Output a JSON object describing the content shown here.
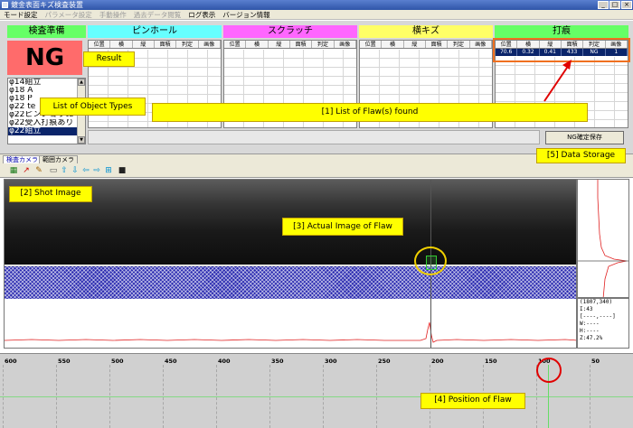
{
  "window": {
    "title": "鍍金表面キズ検査装置"
  },
  "menu": [
    {
      "label": "モード設定",
      "disabled": false
    },
    {
      "label": "パラメータ設定",
      "disabled": true
    },
    {
      "label": "手動操作",
      "disabled": true
    },
    {
      "label": "過去データ閲覧",
      "disabled": true
    },
    {
      "label": "ログ表示",
      "disabled": false
    },
    {
      "label": "バージョン情報",
      "disabled": false
    }
  ],
  "categories": {
    "inspection": "検査準備",
    "pinhole": "ピンホール",
    "scratch": "スクラッチ",
    "horizontal_flaw": "横キズ",
    "dent": "打痕"
  },
  "grid_columns": [
    "位置",
    "横",
    "縦",
    "面積",
    "判定",
    "画像"
  ],
  "dent_row": [
    "70.6",
    "0.32",
    "0.41",
    "433",
    "NG",
    "1"
  ],
  "result": "NG",
  "object_types": [
    "φ14組立",
    "φ18 A",
    "φ18 P",
    "φ22 te",
    "φ22ピンショウte",
    "φ22受入打痕あり",
    "φ22組立"
  ],
  "selected_type_index": 6,
  "buttons": {
    "save": "NG確定保存"
  },
  "tabs": [
    "検査カメラ",
    "範囲カメラ"
  ],
  "readout": {
    "coord": "(1807,340)",
    "l": "I:43",
    "dashes": "[----,----]",
    "w": "W:----",
    "h": "H:----",
    "z": "Z:47.2%"
  },
  "ruler_ticks": [
    600,
    550,
    500,
    450,
    400,
    350,
    300,
    250,
    200,
    150,
    100,
    50
  ],
  "callouts": {
    "result": "Result",
    "object_types": "List of Object Types",
    "flaws": "[1] List of Flaw(s) found",
    "data_storage": "[5] Data Storage",
    "shot_image": "[2] Shot Image",
    "actual_image": "[3] Actual Image of Flaw",
    "position": "[4] Position of Flaw"
  },
  "colors": {
    "inspection": "#66ff66",
    "pinhole": "#66ffff",
    "scratch": "#ff66ff",
    "horizontal_flaw": "#ffff66",
    "dent": "#66ff66",
    "ng_bg": "#ff6b6b",
    "callout": "#ffff00"
  }
}
